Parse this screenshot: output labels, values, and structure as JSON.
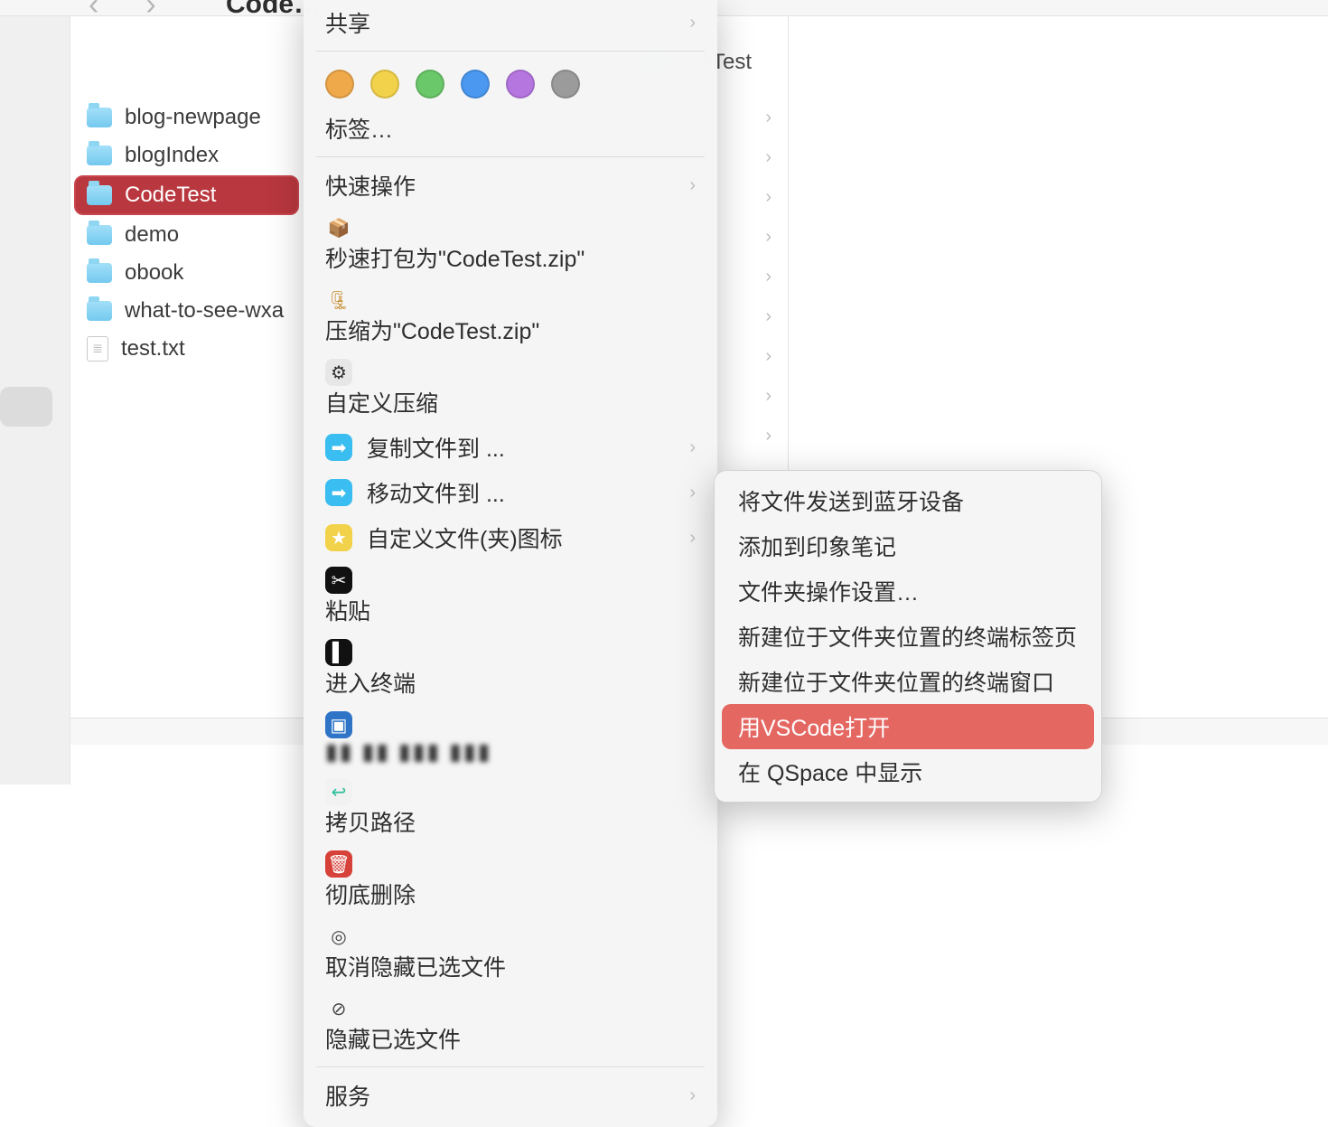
{
  "window": {
    "title_partial": "Code…"
  },
  "path_bar_visible": "odeTest",
  "sidebar_files": [
    {
      "label": "blog-newpage",
      "type": "folder"
    },
    {
      "label": "blogIndex",
      "type": "folder"
    },
    {
      "label": "CodeTest",
      "type": "folder",
      "selected": true
    },
    {
      "label": "demo",
      "type": "folder"
    },
    {
      "label": "obook",
      "type": "folder"
    },
    {
      "label": "what-to-see-wxa",
      "type": "folder"
    },
    {
      "label": "test.txt",
      "type": "file"
    }
  ],
  "column2_row_count": 10,
  "context_menu": {
    "share": {
      "label": "共享"
    },
    "tag_colors": [
      "#f0a94a",
      "#f3d24b",
      "#6ac86a",
      "#4a98f0",
      "#b576e0",
      "#9b9b9b"
    ],
    "tags_label": "标签…",
    "quick_actions": "快速操作",
    "items": [
      {
        "key": "zip_fast",
        "label": "秒速打包为\"CodeTest.zip\"",
        "icon": "zip"
      },
      {
        "key": "zip_as",
        "label": "压缩为\"CodeTest.zip\"",
        "icon": "zip2"
      },
      {
        "key": "custom_zip",
        "label": "自定义压缩",
        "icon": "config"
      },
      {
        "key": "copy_to",
        "label": "复制文件到 ...",
        "icon": "copy",
        "submenu": true
      },
      {
        "key": "move_to",
        "label": "移动文件到 ...",
        "icon": "move",
        "submenu": true
      },
      {
        "key": "custom_icon",
        "label": "自定义文件(夹)图标",
        "icon": "star",
        "submenu": true
      },
      {
        "key": "paste",
        "label": "粘贴",
        "icon": "paste"
      },
      {
        "key": "enter_terminal",
        "label": "进入终端",
        "icon": "term"
      },
      {
        "key": "obscured",
        "label": "▮▮ ▮▮ ▮▮▮ ▮▮▮",
        "icon": "dx",
        "obscured": true
      },
      {
        "key": "copy_path",
        "label": "拷贝路径",
        "icon": "path"
      },
      {
        "key": "delete_forever",
        "label": "彻底删除",
        "icon": "trash"
      },
      {
        "key": "unhide",
        "label": "取消隐藏已选文件",
        "icon": "eye"
      },
      {
        "key": "hide",
        "label": "隐藏已选文件",
        "icon": "eyeslash"
      }
    ],
    "services_label": "服务"
  },
  "services_submenu": [
    {
      "label": "将文件发送到蓝牙设备"
    },
    {
      "label": "添加到印象笔记"
    },
    {
      "label": "文件夹操作设置…"
    },
    {
      "label": "新建位于文件夹位置的终端标签页"
    },
    {
      "label": "新建位于文件夹位置的终端窗口"
    },
    {
      "label": "用VSCode打开",
      "highlighted": true
    },
    {
      "label": "在 QSpace 中显示"
    }
  ]
}
